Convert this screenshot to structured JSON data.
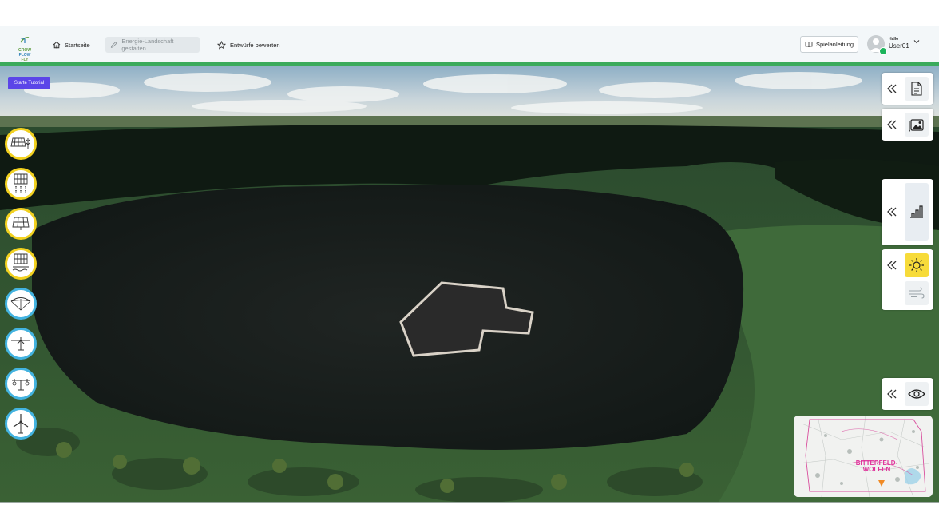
{
  "header": {
    "logo": {
      "line1": "GROW",
      "line2": "FLOW",
      "line3": "FLY"
    },
    "nav": [
      {
        "label": "Startseite",
        "icon": "home-icon"
      },
      {
        "label": "Energie-Landschaft gestalten",
        "icon": "pencil-icon"
      },
      {
        "label": "Entwürfe bewerten",
        "icon": "star-icon"
      }
    ],
    "guide_label": "Spielanleitung",
    "user": {
      "greeting": "Hallo",
      "name": "User01"
    }
  },
  "tutorial_label": "Starte Tutorial",
  "tools": [
    {
      "name": "agri-pv-crops",
      "category": "solar"
    },
    {
      "name": "agri-pv-vertical",
      "category": "solar"
    },
    {
      "name": "ground-pv",
      "category": "solar"
    },
    {
      "name": "floating-pv",
      "category": "solar"
    },
    {
      "name": "kite-power",
      "category": "air"
    },
    {
      "name": "airborne-wing",
      "category": "air"
    },
    {
      "name": "airborne-drone",
      "category": "air"
    },
    {
      "name": "wind-turbine",
      "category": "air"
    }
  ],
  "minimap": {
    "label_line1": "BITTERFELD-",
    "label_line2": "WOLFEN"
  },
  "colors": {
    "accent": "#5b45e8",
    "green": "#3aaa5c",
    "solar": "#f2d11f",
    "air": "#43b3e0",
    "sun_active": "#f7db3a"
  }
}
